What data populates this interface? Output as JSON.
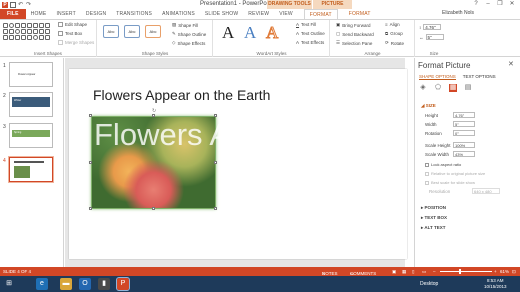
{
  "window": {
    "title": "Presentation1 - PowerPoint",
    "context_drawing": "DRAWING TOOLS",
    "context_picture": "PICTURE TOOLS",
    "user": "Elizabeth Nols",
    "help": "?"
  },
  "tabs": [
    {
      "label": "FILE"
    },
    {
      "label": "HOME"
    },
    {
      "label": "INSERT"
    },
    {
      "label": "DESIGN"
    },
    {
      "label": "TRANSITIONS"
    },
    {
      "label": "ANIMATIONS"
    },
    {
      "label": "SLIDE SHOW"
    },
    {
      "label": "REVIEW"
    },
    {
      "label": "VIEW"
    },
    {
      "label": "FORMAT"
    },
    {
      "label": "FORMAT"
    }
  ],
  "ribbon": {
    "insert_shapes": {
      "label": "Insert Shapes",
      "edit_shape": "Edit Shape",
      "text_box": "Text Box",
      "merge_shapes": "Merge Shapes"
    },
    "shape_styles": {
      "label": "Shape Styles",
      "abc": [
        "Abc",
        "Abc",
        "Abc"
      ],
      "shape_fill": "Shape Fill",
      "shape_outline": "Shape Outline",
      "shape_effects": "Shape Effects"
    },
    "wordart": {
      "label": "WordArt Styles",
      "letters": [
        "A",
        "A",
        "A"
      ],
      "text_fill": "Text Fill",
      "text_outline": "Text Outline",
      "text_effects": "Text Effects"
    },
    "arrange": {
      "label": "Arrange",
      "bring_forward": "Bring Forward",
      "send_backward": "Send Backward",
      "selection_pane": "Selection Pane",
      "align": "Align",
      "group": "Group",
      "rotate": "Rotate"
    },
    "size": {
      "label": "Size",
      "height": "4.76\"",
      "width": "5\""
    }
  },
  "slides": [
    {
      "num": "1",
      "text": "Flowers Appear"
    },
    {
      "num": "2",
      "text": "Winter"
    },
    {
      "num": "3",
      "text": "Spring"
    },
    {
      "num": "4",
      "text": ""
    }
  ],
  "slide": {
    "title": "Flowers Appear on the Earth",
    "image_text": "Flowers Appear"
  },
  "format_pane": {
    "title": "Format Picture",
    "tab_shape": "SHAPE OPTIONS",
    "tab_text": "TEXT OPTIONS",
    "size_section": "SIZE",
    "props": [
      {
        "label": "Height",
        "value": "4.76\""
      },
      {
        "label": "Width",
        "value": "5\""
      },
      {
        "label": "Rotation",
        "value": "0°"
      },
      {
        "label": "Scale Height",
        "value": "100%"
      },
      {
        "label": "Scale Width",
        "value": "43%"
      }
    ],
    "lock_aspect": "Lock aspect ratio",
    "relative": "Relative to original picture size",
    "best_scale": "Best scale for slide show",
    "resolution_label": "Resolution",
    "resolution_value": "640 x 480",
    "sections": [
      "POSITION",
      "TEXT BOX",
      "ALT TEXT"
    ]
  },
  "status": {
    "slide": "SLIDE 4 OF 4",
    "notes": "NOTES",
    "comments": "COMMENTS",
    "zoom": "61%"
  },
  "taskbar": {
    "desktop": "Desktop",
    "time": "8:53 AM",
    "date": "10/15/2013"
  },
  "colors": {
    "accent": "#d24726",
    "taskbar": "#1e3a5a"
  }
}
